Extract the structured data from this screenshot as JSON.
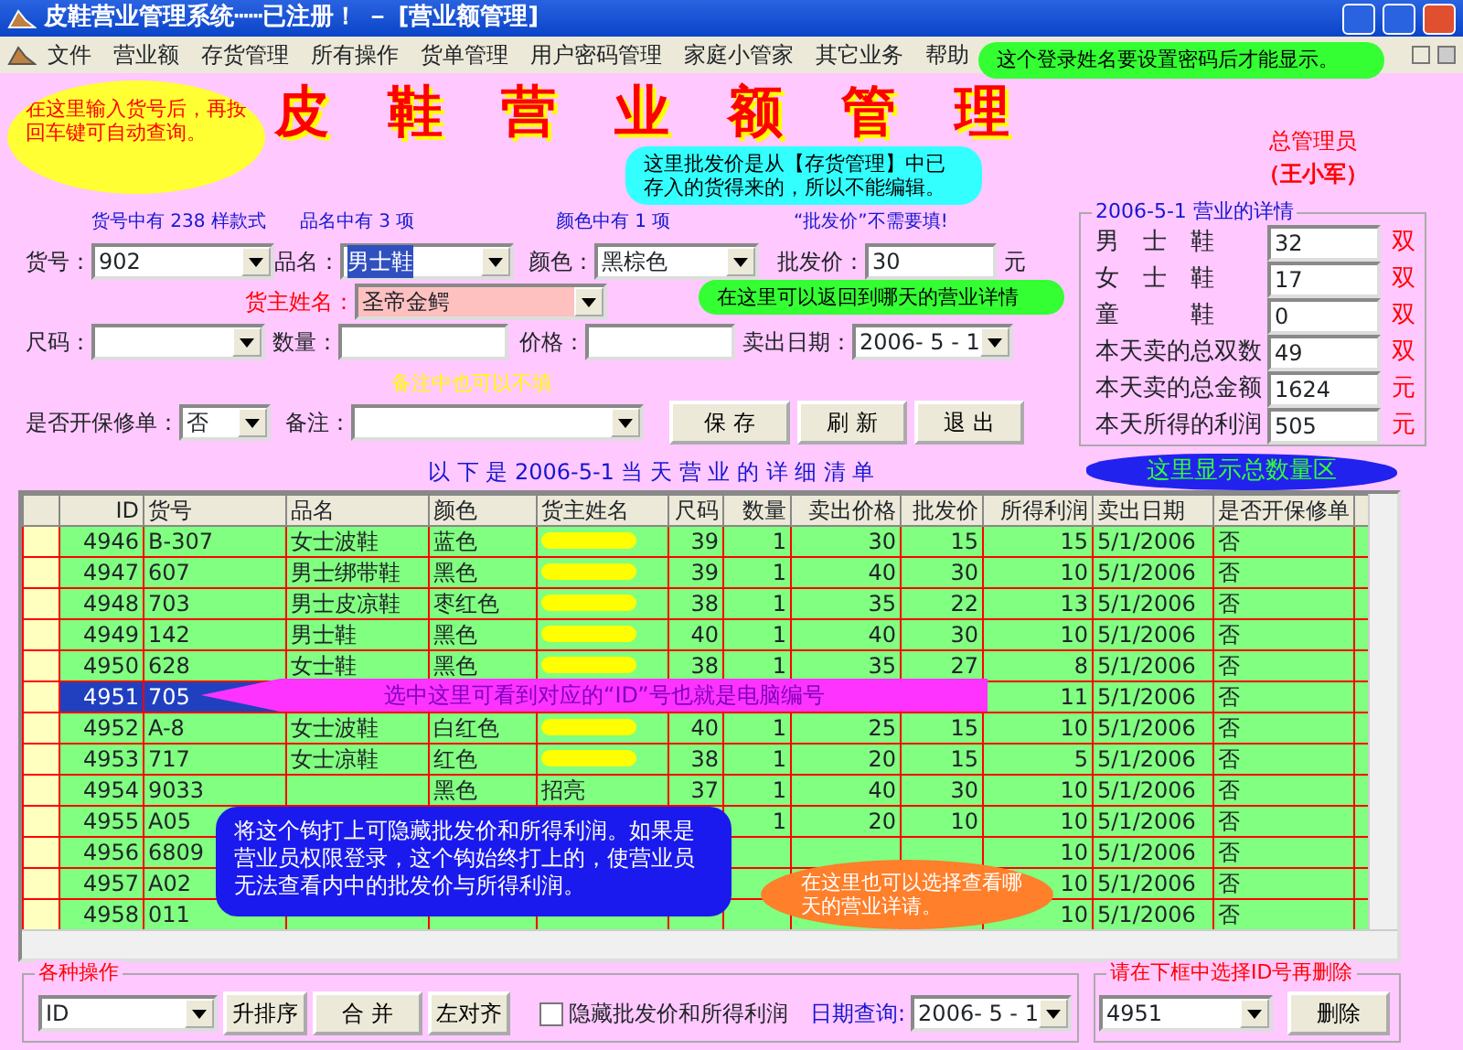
{
  "window": {
    "title": "皮鞋营业管理系统┅┅已注册！ － [营业额管理]"
  },
  "menu": [
    "文件",
    "营业额",
    "存货管理",
    "所有操作",
    "货单管理",
    "用户密码管理",
    "家庭小管家",
    "其它业务",
    "帮助"
  ],
  "header": {
    "title": "皮鞋营业额管理",
    "role": "总管理员",
    "user": "（王小军）"
  },
  "form": {
    "info": [
      "货号中有 238 样款式",
      "品名中有 3 项",
      "颜色中有 1 项",
      "“批发价”不需要填!"
    ],
    "item_no": {
      "label": "货号：",
      "value": "902"
    },
    "product": {
      "label": "品名：",
      "value": "男士鞋"
    },
    "color": {
      "label": "颜色：",
      "value": "黑棕色"
    },
    "wholesale": {
      "label": "批发价：",
      "value": "30",
      "unit": "元"
    },
    "owner": {
      "label": "货主姓名：",
      "value": "圣帝金鳄"
    },
    "size": {
      "label": "尺码："
    },
    "quantity": {
      "label": "数量："
    },
    "price": {
      "label": "价格："
    },
    "sale_date": {
      "label": "卖出日期：",
      "value": "2006- 5 - 1"
    },
    "note_hint": "备注中也可以不填",
    "warranty": {
      "label": "是否开保修单：",
      "value": "否"
    },
    "remark": {
      "label": "备注："
    },
    "buttons": [
      "保  存",
      "刷 新",
      "退  出"
    ],
    "list_title": "以 下 是 2006-5-1 当 天 营 业 的 详 细 清 单"
  },
  "summary": {
    "title": "2006-5-1 营业的详情",
    "rows": [
      {
        "label": "男　士　鞋",
        "value": "32",
        "unit": "双"
      },
      {
        "label": "女　士　鞋",
        "value": "17",
        "unit": "双"
      },
      {
        "label": "童　　　鞋",
        "value": "0",
        "unit": "双"
      },
      {
        "label": "本天卖的总双数",
        "value": "49",
        "unit": "双"
      },
      {
        "label": "本天卖的总金额",
        "value": "1624",
        "unit": "元"
      },
      {
        "label": "本天所得的利润",
        "value": "505",
        "unit": "元"
      }
    ]
  },
  "table": {
    "columns": [
      "ID",
      "货号",
      "品名",
      "颜色",
      "货主姓名",
      "尺码",
      "数量",
      "卖出价格",
      "批发价",
      "所得利润",
      "卖出日期",
      "是否开保修单"
    ],
    "rows": [
      {
        "selected": false,
        "owner_redacted": true,
        "cells": [
          "4946",
          "B-307",
          "女士波鞋",
          "蓝色",
          "",
          "39",
          "1",
          "30",
          "15",
          "15",
          "5/1/2006",
          "否"
        ]
      },
      {
        "selected": false,
        "owner_redacted": true,
        "cells": [
          "4947",
          "607",
          "男士绑带鞋",
          "黑色",
          "",
          "39",
          "1",
          "40",
          "30",
          "10",
          "5/1/2006",
          "否"
        ]
      },
      {
        "selected": false,
        "owner_redacted": true,
        "cells": [
          "4948",
          "703",
          "男士皮凉鞋",
          "枣红色",
          "",
          "38",
          "1",
          "35",
          "22",
          "13",
          "5/1/2006",
          "否"
        ]
      },
      {
        "selected": false,
        "owner_redacted": true,
        "cells": [
          "4949",
          "142",
          "男士鞋",
          "黑色",
          "",
          "40",
          "1",
          "40",
          "30",
          "10",
          "5/1/2006",
          "否"
        ]
      },
      {
        "selected": false,
        "owner_redacted": true,
        "cells": [
          "4950",
          "628",
          "女士鞋",
          "黑色",
          "",
          "38",
          "1",
          "35",
          "27",
          "8",
          "5/1/2006",
          "否"
        ]
      },
      {
        "selected": true,
        "owner_redacted": false,
        "cells": [
          "4951",
          "705",
          "",
          "",
          "",
          "",
          "",
          "",
          "",
          "11",
          "5/1/2006",
          "否"
        ]
      },
      {
        "selected": false,
        "owner_redacted": true,
        "cells": [
          "4952",
          "A-8",
          "女士波鞋",
          "白红色",
          "",
          "40",
          "1",
          "25",
          "15",
          "10",
          "5/1/2006",
          "否"
        ]
      },
      {
        "selected": false,
        "owner_redacted": true,
        "cells": [
          "4953",
          "717",
          "女士凉鞋",
          "红色",
          "",
          "38",
          "1",
          "20",
          "15",
          "5",
          "5/1/2006",
          "否"
        ]
      },
      {
        "selected": false,
        "owner_redacted": false,
        "cells": [
          "4954",
          "9033",
          "",
          "黑色",
          "招亮",
          "37",
          "1",
          "40",
          "30",
          "10",
          "5/1/2006",
          "否"
        ]
      },
      {
        "selected": false,
        "owner_redacted": false,
        "cells": [
          "4955",
          "A05",
          "",
          "",
          "",
          "",
          "1",
          "20",
          "10",
          "10",
          "5/1/2006",
          "否"
        ]
      },
      {
        "selected": false,
        "owner_redacted": false,
        "cells": [
          "4956",
          "6809",
          "",
          "",
          "",
          "",
          "",
          "",
          "",
          "10",
          "5/1/2006",
          "否"
        ]
      },
      {
        "selected": false,
        "owner_redacted": false,
        "cells": [
          "4957",
          "A02",
          "",
          "",
          "",
          "",
          "",
          "",
          "",
          "10",
          "5/1/2006",
          "否"
        ]
      },
      {
        "selected": false,
        "owner_redacted": false,
        "cells": [
          "4958",
          "011",
          "",
          "",
          "",
          "",
          "",
          "",
          "",
          "10",
          "5/1/2006",
          "否"
        ]
      }
    ]
  },
  "operations": {
    "title": "各种操作",
    "sort_field": "ID",
    "buttons": [
      "升排序",
      "合  并",
      "左对齐"
    ],
    "hide_cost": {
      "label": "隐藏批发价和所得利润",
      "checked": false
    },
    "date_label": "日期查询:",
    "date": "2006- 5 - 1"
  },
  "delete": {
    "title": "请在下框中选择ID号再删除",
    "id": "4951",
    "button": "删除"
  },
  "callouts": [
    {
      "kind": "ellipse",
      "color": "#ffff33",
      "text": "在这里输入货号后，再按回车键可自动查询。"
    },
    {
      "kind": "bubble",
      "color": "#33ff33",
      "text": "这个登录姓名要设置密码后才能显示。"
    },
    {
      "kind": "bubble",
      "color": "#33ffff",
      "text": "这里批发价是从【存货管理】中已存入的货得来的，所以不能编辑。"
    },
    {
      "kind": "bubble",
      "color": "#33ff33",
      "text": "在这里可以返回到哪天的营业详情"
    },
    {
      "kind": "cloud",
      "color": "#2222ee",
      "text": "这里显示总数量区"
    },
    {
      "kind": "arrow",
      "color": "#ff33ff",
      "text": "选中这里可看到对应的“ID”号也就是电脑编号"
    },
    {
      "kind": "bubble",
      "color": "#1a1aee",
      "text": "将这个钩打上可隐藏批发价和所得利润。如果是营业员权限登录，这个钩始终打上的，使营业员无法查看内中的批发价与所得利润。"
    },
    {
      "kind": "ellipse",
      "color": "#ff7f2a",
      "text": "在这里也可以选择查看哪天的营业详请。"
    }
  ]
}
